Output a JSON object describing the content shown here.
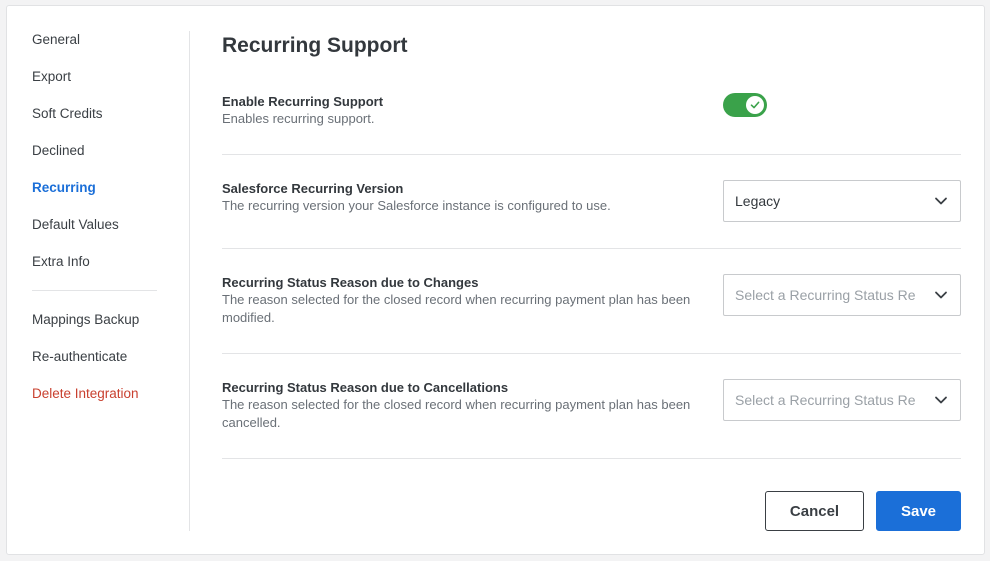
{
  "sidebar": {
    "items": [
      {
        "label": "General"
      },
      {
        "label": "Export"
      },
      {
        "label": "Soft Credits"
      },
      {
        "label": "Declined"
      },
      {
        "label": "Recurring"
      },
      {
        "label": "Default Values"
      },
      {
        "label": "Extra Info"
      }
    ],
    "secondary_items": [
      {
        "label": "Mappings Backup"
      },
      {
        "label": "Re-authenticate"
      },
      {
        "label": "Delete Integration"
      }
    ],
    "active_item": "Recurring"
  },
  "main": {
    "title": "Recurring Support",
    "rows": [
      {
        "label": "Enable Recurring Support",
        "description": "Enables recurring support.",
        "control": "toggle",
        "enabled": true
      },
      {
        "label": "Salesforce Recurring Version",
        "description": "The recurring version your Salesforce instance is configured to use.",
        "control": "select",
        "value": "Legacy"
      },
      {
        "label": "Recurring Status Reason due to Changes",
        "description": "The reason selected for the closed record when recurring payment plan has been modified.",
        "control": "select",
        "placeholder": "Select a Recurring Status Re"
      },
      {
        "label": "Recurring Status Reason due to Cancellations",
        "description": "The reason selected for the closed record when recurring payment plan has been cancelled.",
        "control": "select",
        "placeholder": "Select a Recurring Status Re"
      }
    ]
  },
  "footer": {
    "cancel_label": "Cancel",
    "save_label": "Save"
  },
  "colors": {
    "accent": "#1b6fd8",
    "toggle_on": "#3aa24a",
    "danger": "#c9402f"
  }
}
